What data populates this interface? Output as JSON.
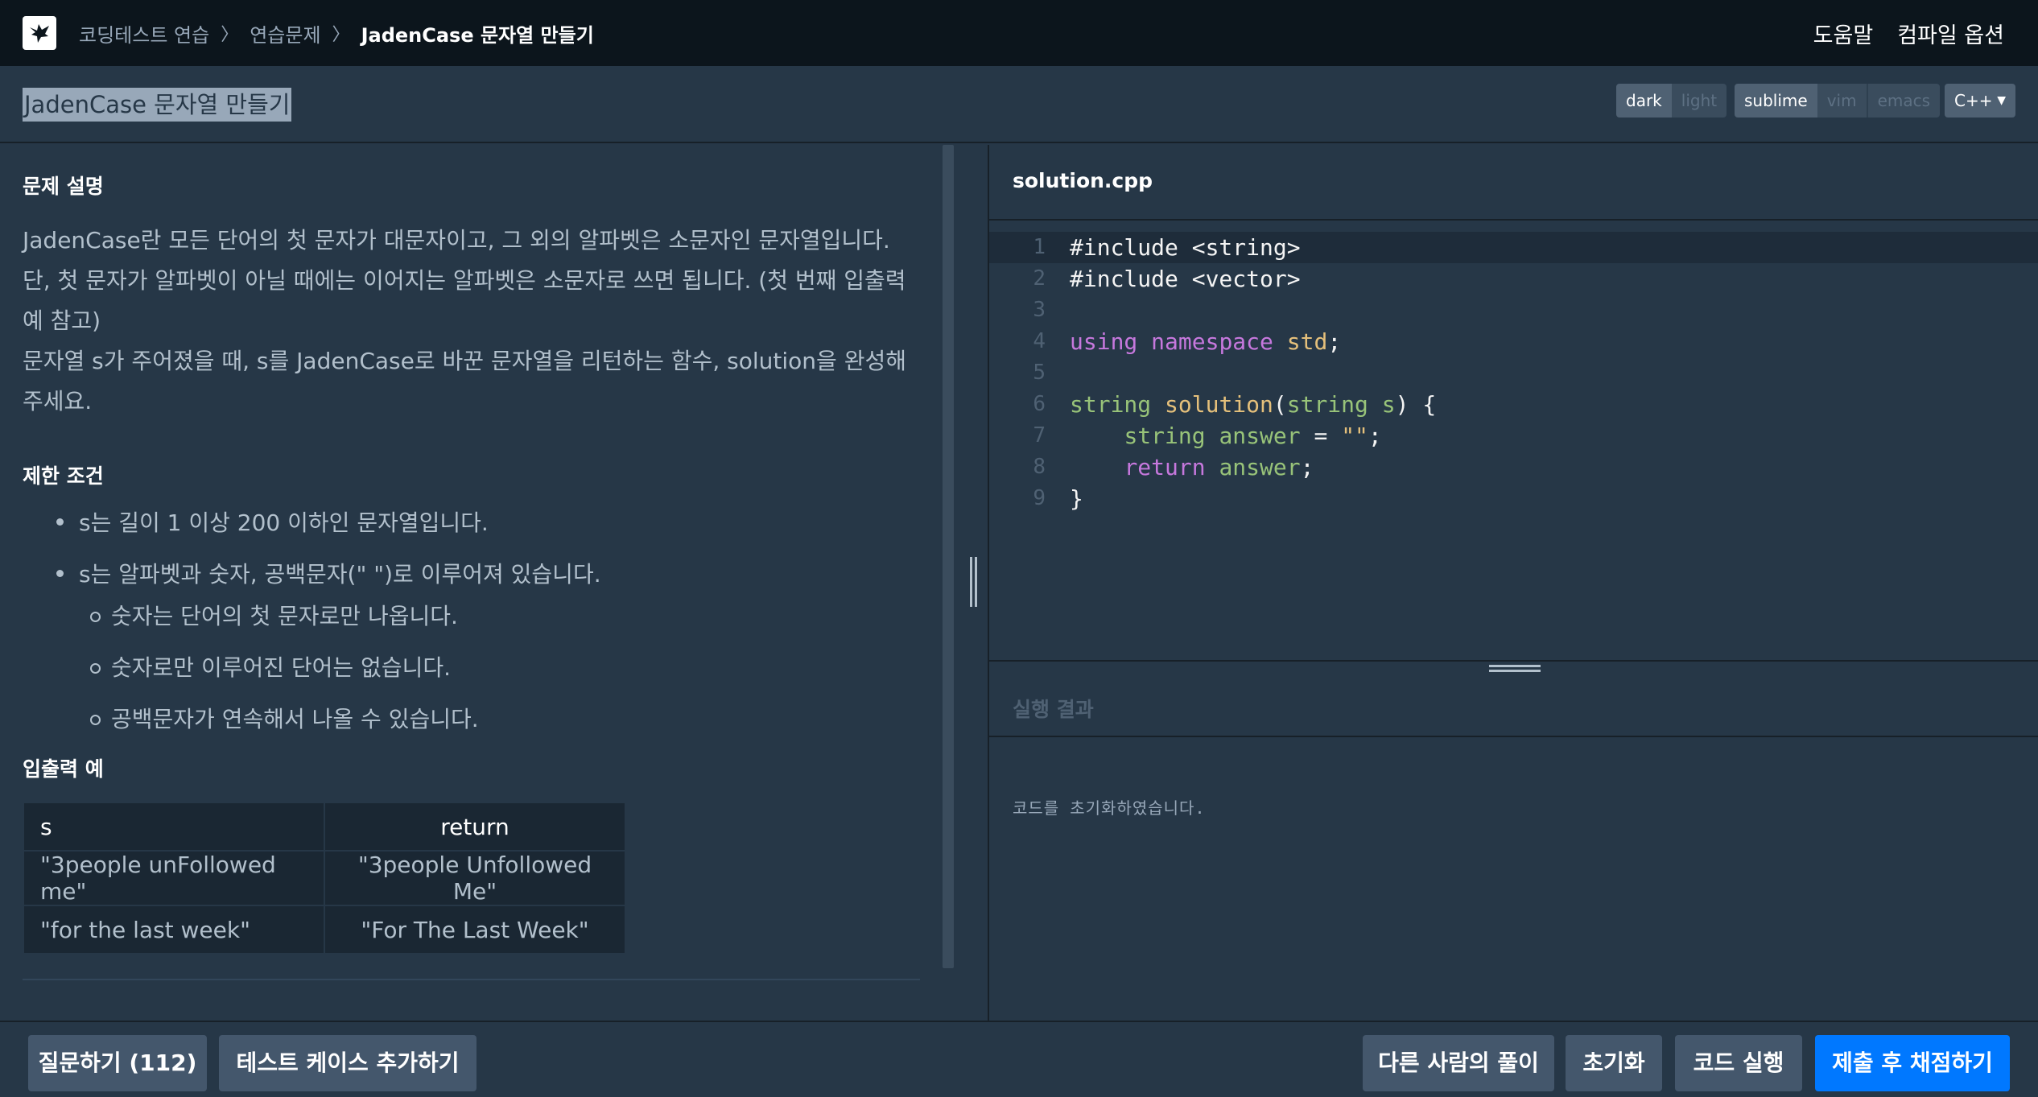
{
  "nav": {
    "breadcrumbs": [
      "코딩테스트 연습",
      "연습문제",
      "JadenCase 문자열 만들기"
    ],
    "separator": "〉",
    "links": [
      "도움말",
      "컴파일 옵션"
    ]
  },
  "subheader": {
    "title": "JadenCase 문자열 만들기",
    "theme": {
      "options": [
        "dark",
        "light"
      ],
      "selected": "dark"
    },
    "keymap": {
      "options": [
        "sublime",
        "vim",
        "emacs"
      ],
      "selected": "sublime"
    },
    "language": "C++"
  },
  "problem": {
    "description_title": "문제 설명",
    "description": [
      "JadenCase란 모든 단어의 첫 문자가 대문자이고, 그 외의 알파벳은 소문자인 문자열입니다. 단, 첫 문자가 알파벳이 아닐 때에는 이어지는 알파벳은 소문자로 쓰면 됩니다. (첫 번째 입출력 예 참고)",
      "문자열 s가 주어졌을 때, s를 JadenCase로 바꾼 문자열을 리턴하는 함수, solution을 완성해주세요."
    ],
    "constraints_title": "제한 조건",
    "constraint_1": "s는 길이 1 이상 200 이하인 문자열입니다.",
    "constraint_2": "s는 알파벳과 숫자, 공백문자(\" \")로 이루어져 있습니다.",
    "sub_constraints": [
      "숫자는 단어의 첫 문자로만 나옵니다.",
      "숫자로만 이루어진 단어는 없습니다.",
      "공백문자가 연속해서 나올 수 있습니다."
    ],
    "examples_title": "입출력 예",
    "examples": {
      "headers": [
        "s",
        "return"
      ],
      "rows": [
        [
          "\"3people unFollowed me\"",
          "\"3people Unfollowed Me\""
        ],
        [
          "\"for the last week\"",
          "\"For The Last Week\""
        ]
      ]
    }
  },
  "editor": {
    "filename": "solution.cpp",
    "line_numbers": [
      "1",
      "2",
      "3",
      "4",
      "5",
      "6",
      "7",
      "8",
      "9"
    ],
    "code_lines": [
      "#include <string>",
      "#include <vector>",
      "",
      "using namespace std;",
      "",
      "string solution(string s) {",
      "    string answer = \"\";",
      "    return answer;",
      "}"
    ]
  },
  "result": {
    "title": "실행 결과",
    "message": "코드를 초기화하였습니다."
  },
  "footer": {
    "left_buttons": [
      "질문하기 (112)",
      "테스트 케이스 추가하기"
    ],
    "right_buttons": [
      "다른 사람의 풀이",
      "초기화",
      "코드 실행",
      "제출 후 채점하기"
    ]
  },
  "colors": {
    "nav_background": "#0c151c",
    "panel_background": "#263747",
    "primary": "#0078ff",
    "keyword": "#c678dd",
    "type": "#98c379",
    "function": "#e5c07b"
  }
}
